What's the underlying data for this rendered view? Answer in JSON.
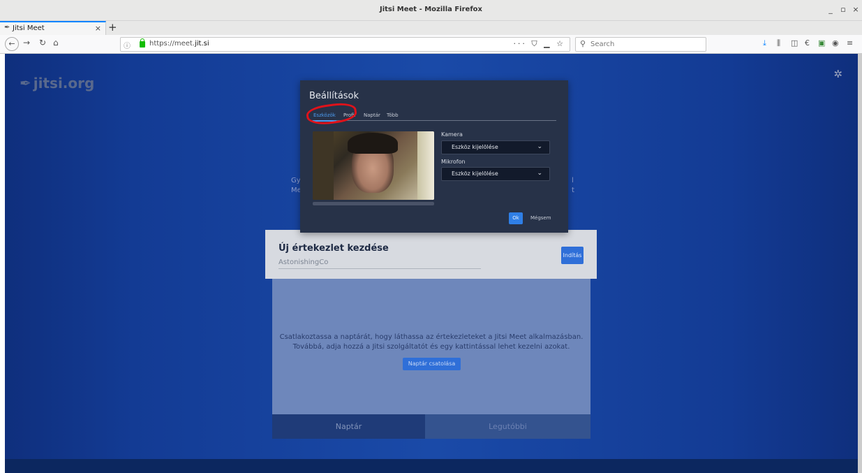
{
  "window": {
    "title": "Jitsi Meet - Mozilla Firefox",
    "controls": [
      "_",
      "▫",
      "×"
    ]
  },
  "browser": {
    "tab_label": "Jitsi Meet",
    "url_prefix": "https://meet.",
    "url_domain": "jit.si",
    "url_actions": "··· ⛉ ▁ ☆",
    "search_placeholder": "Search"
  },
  "page": {
    "logo": "jitsi.org",
    "hint_left": "Gy\nMe",
    "hint_right": "l\nt",
    "new_meeting_title": "Új értekezlet kezdése",
    "room_name": "AstonishingCo",
    "start_button": "Indítás",
    "calendar_message_line1": "Csatlakoztassa a naptárát, hogy láthassa az értekezleteket a Jitsi Meet alkalmazásban.",
    "calendar_message_line2": "Továbbá, adja hozzá a Jitsi szolgáltatót és egy kattintással lehet kezelni azokat.",
    "connect_calendar": "Naptár csatolása",
    "tab_calendar": "Naptár",
    "tab_recent": "Legutóbbi"
  },
  "dialog": {
    "title": "Beállítások",
    "tabs": [
      "Eszközök",
      "Profil",
      "Naptár",
      "Több"
    ],
    "camera_label": "Kamera",
    "camera_value": "Eszköz kijelölése",
    "microphone_label": "Mikrofon",
    "microphone_value": "Eszköz kijelölése",
    "ok": "Ok",
    "cancel": "Mégsem"
  },
  "colors": {
    "annotation": "#e0121a",
    "accent": "#4c9bf0"
  }
}
